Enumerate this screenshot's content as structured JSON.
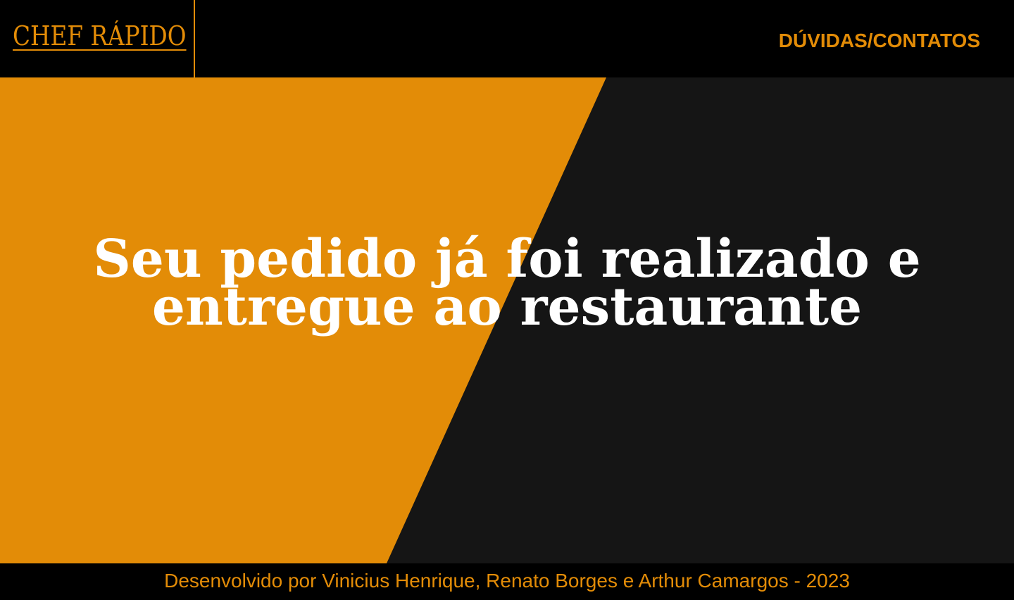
{
  "header": {
    "logo_text": "CHEF RÁPIDO",
    "nav_contact_label": "DÚVIDAS/CONTATOS"
  },
  "hero": {
    "title_line1": "Seu pedido já foi realizado e",
    "title_line2": "entregue ao restaurante"
  },
  "footer": {
    "credits": "Desenvolvido por Vinicius Henrique, Renato Borges e Arthur Camargos - 2023"
  },
  "colors": {
    "accent": "#e38c07",
    "background_dark": "#151515",
    "header_bg": "#000000",
    "title_text": "#ffffff"
  }
}
